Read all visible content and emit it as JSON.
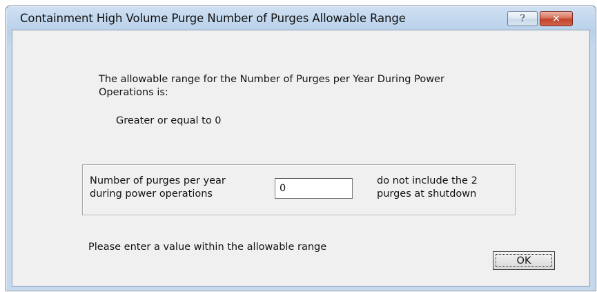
{
  "window": {
    "title": "Containment High Volume Purge Number of Purges Allowable Range",
    "help_glyph": "?",
    "close_glyph": "✕"
  },
  "info": {
    "line1": "The allowable range for the Number of Purges per Year During Power",
    "line2": "Operations is:",
    "range": "Greater or equal to 0"
  },
  "group": {
    "label_line1": "Number of purges per year",
    "label_line2": "during power operations",
    "value": "0",
    "note_line1": "do not include the 2",
    "note_line2": "purges at shutdown"
  },
  "prompt": "Please enter a value within the allowable range",
  "ok_label": "OK"
}
